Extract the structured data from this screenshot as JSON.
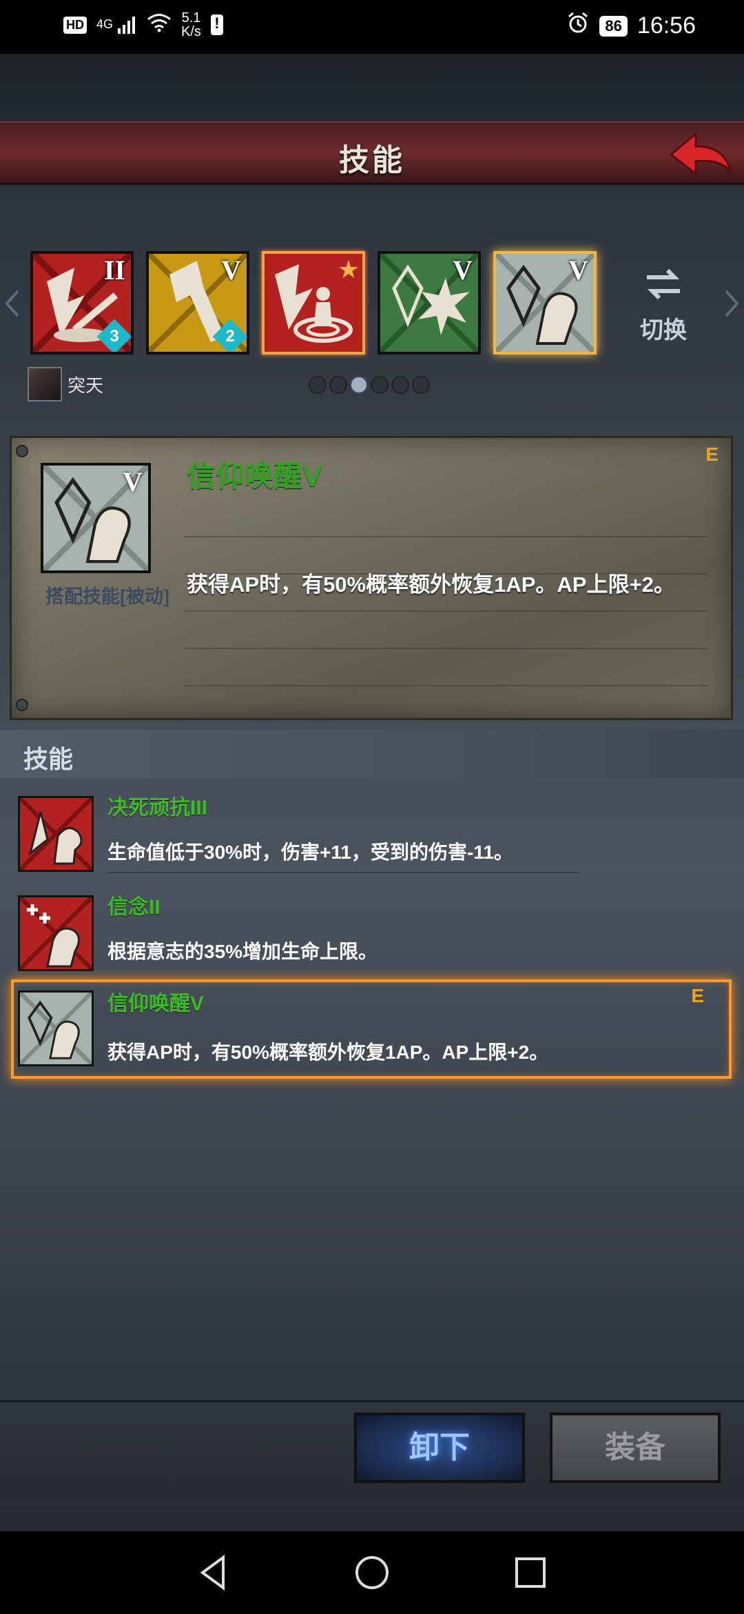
{
  "status_bar": {
    "hd": "HD",
    "signal": "4G",
    "net_speed_value": "5.1",
    "net_speed_unit": "K/s",
    "battery": "86",
    "time": "16:56"
  },
  "title": "技能",
  "skill_slots": [
    {
      "level": "II",
      "badge": "3",
      "color": "#b3221f"
    },
    {
      "level": "V",
      "badge": "2",
      "color": "#c89a14"
    },
    {
      "level": "",
      "badge": "",
      "color": "#b3221f",
      "starred": true
    },
    {
      "level": "V",
      "badge": "",
      "color": "#3c7a3f"
    },
    {
      "level": "V",
      "badge": "",
      "color": "#a7b3ad"
    }
  ],
  "switch_label": "切换",
  "character": {
    "name": "突天"
  },
  "pager": {
    "total": 6,
    "active": 3
  },
  "detail": {
    "level": "V",
    "type": "搭配技能[被动]",
    "name": "信仰唤醒V",
    "tag": "E",
    "description": "获得AP时，有50%概率额外恢复1AP。AP上限+2。"
  },
  "list": {
    "title": "技能",
    "items": [
      {
        "name": "决死顽抗III",
        "description": "生命值低于30%时，伤害+11，受到的伤害-11。",
        "color": "#b3221f"
      },
      {
        "name": "信念II",
        "description": "根据意志的35%增加生命上限。",
        "color": "#b3221f"
      },
      {
        "name": "信仰唤醒V",
        "description": "获得AP时，有50%概率额外恢复1AP。AP上限+2。",
        "tag": "E",
        "color": "#a7b3ad"
      }
    ]
  },
  "buttons": {
    "unequip": "卸下",
    "equip": "装备"
  }
}
